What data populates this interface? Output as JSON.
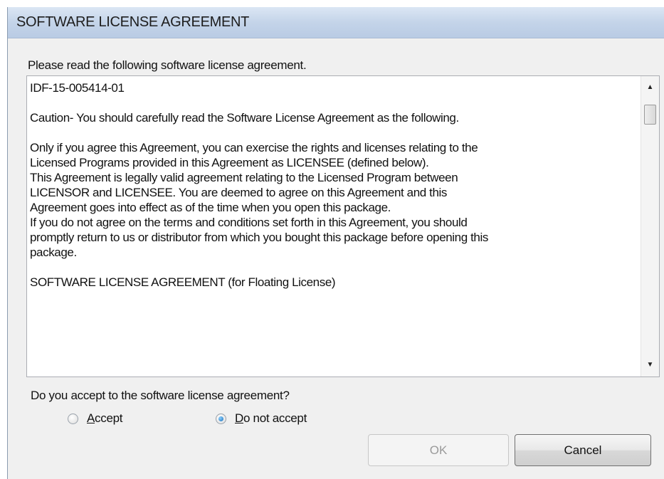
{
  "window": {
    "title": "SOFTWARE LICENSE AGREEMENT"
  },
  "prompt": "Please read the following software license agreement.",
  "license": {
    "paragraphs": [
      "IDF-15-005414-01",
      "Caution- You should carefully read the Software License Agreement as the following.",
      "Only if you agree this Agreement, you can exercise the rights and licenses relating to the\nLicensed Programs provided in this Agreement as LICENSEE (defined below).\nThis Agreement is legally valid agreement relating to the Licensed Program between\nLICENSOR and LICENSEE.  You are deemed to agree on this Agreement and this\nAgreement goes into effect as of the time when you open this package.\nIf you do not agree on the terms and conditions set forth in this Agreement, you should\npromptly return to us or distributor from which you bought this package before opening this\npackage.",
      "SOFTWARE LICENSE AGREEMENT (for Floating License)"
    ]
  },
  "question": "Do you accept to the software license agreement?",
  "options": {
    "accept": {
      "label_mnemonic": "A",
      "label_rest": "ccept",
      "selected": false
    },
    "decline": {
      "label_mnemonic": "D",
      "label_rest": "o not accept",
      "selected": true
    }
  },
  "buttons": {
    "ok": {
      "label": "OK",
      "enabled": false
    },
    "cancel": {
      "label": "Cancel",
      "enabled": true
    }
  },
  "icons": {
    "scroll_up": "scroll-up-arrow-icon",
    "scroll_down": "scroll-down-arrow-icon"
  },
  "colors": {
    "titlebar": "#c4d4e9",
    "radio_selected": "#1a6fb8"
  }
}
